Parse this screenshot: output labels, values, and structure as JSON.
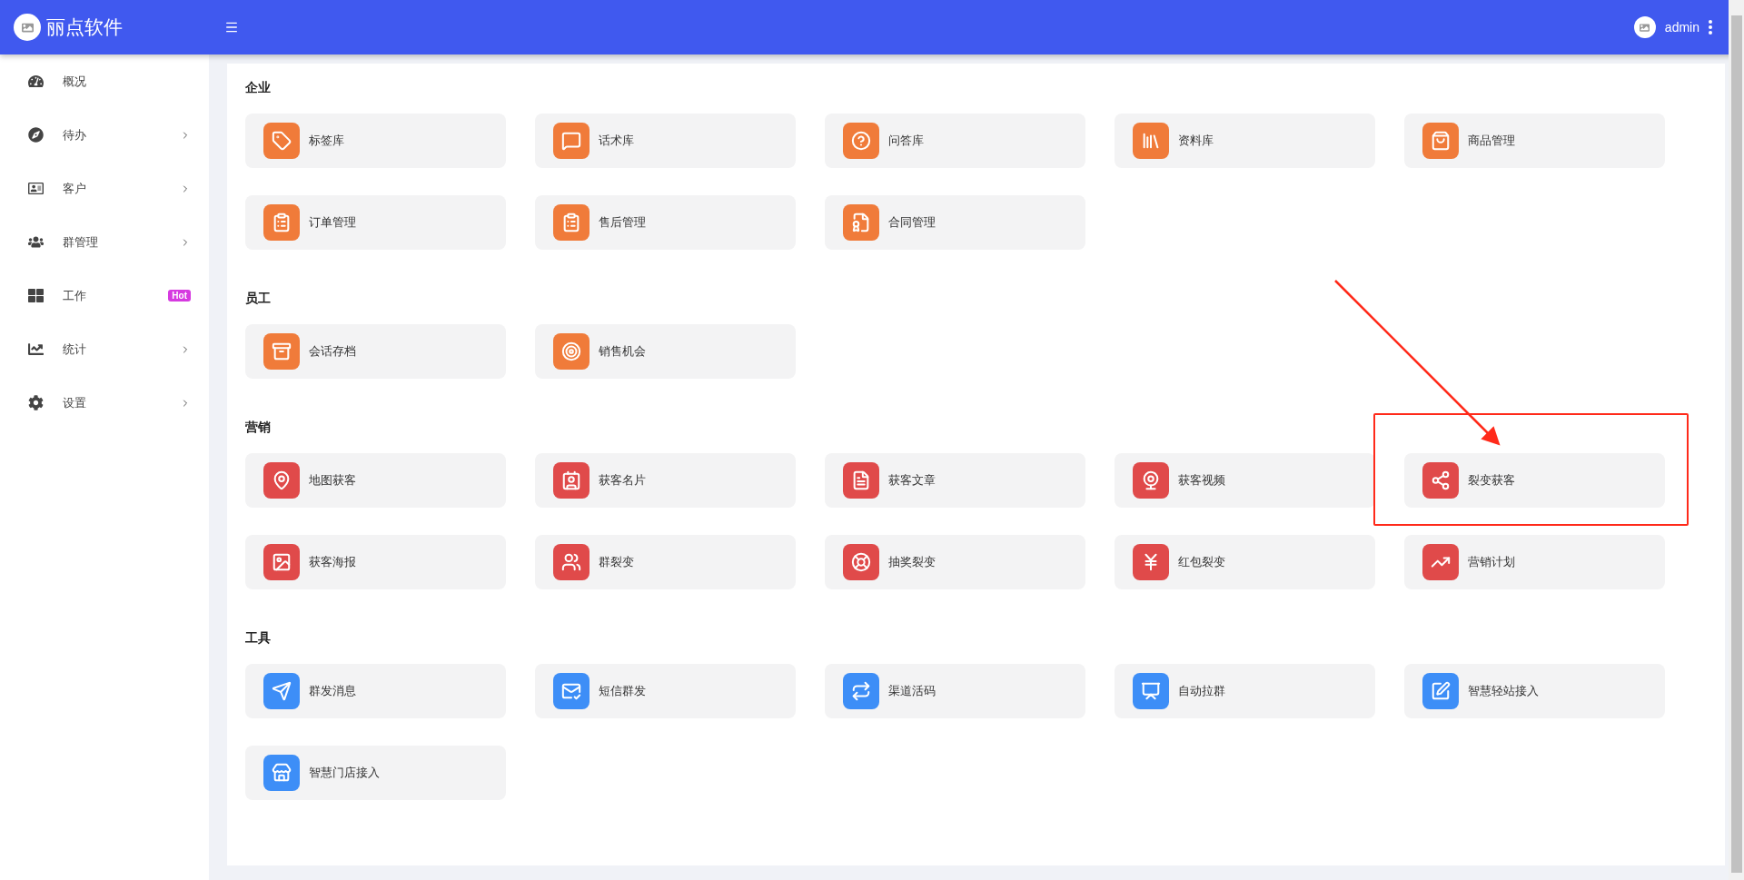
{
  "app": {
    "name": "丽点软件"
  },
  "header": {
    "user": "admin"
  },
  "sidebar": {
    "items": [
      {
        "label": "概况",
        "has_submenu": false
      },
      {
        "label": "待办",
        "has_submenu": true
      },
      {
        "label": "客户",
        "has_submenu": true
      },
      {
        "label": "群管理",
        "has_submenu": true
      },
      {
        "label": "工作",
        "has_submenu": false,
        "badge": "Hot"
      },
      {
        "label": "统计",
        "has_submenu": true
      },
      {
        "label": "设置",
        "has_submenu": true
      }
    ]
  },
  "sections": [
    {
      "title": "企业",
      "color": "#f07b3a",
      "tiles": [
        {
          "label": "标签库"
        },
        {
          "label": "话术库"
        },
        {
          "label": "问答库"
        },
        {
          "label": "资料库"
        },
        {
          "label": "商品管理"
        },
        {
          "label": "订单管理"
        },
        {
          "label": "售后管理"
        },
        {
          "label": "合同管理"
        }
      ]
    },
    {
      "title": "员工",
      "color": "#f07b3a",
      "tiles": [
        {
          "label": "会话存档"
        },
        {
          "label": "销售机会"
        }
      ]
    },
    {
      "title": "营销",
      "color": "#e04a4a",
      "tiles": [
        {
          "label": "地图获客"
        },
        {
          "label": "获客名片"
        },
        {
          "label": "获客文章"
        },
        {
          "label": "获客视频"
        },
        {
          "label": "裂变获客",
          "highlighted": true
        },
        {
          "label": "获客海报"
        },
        {
          "label": "群裂变"
        },
        {
          "label": "抽奖裂变"
        },
        {
          "label": "红包裂变"
        },
        {
          "label": "营销计划"
        }
      ]
    },
    {
      "title": "工具",
      "color": "#3d8ef7",
      "tiles": [
        {
          "label": "群发消息"
        },
        {
          "label": "短信群发"
        },
        {
          "label": "渠道活码"
        },
        {
          "label": "自动拉群"
        },
        {
          "label": "智慧轻站接入"
        },
        {
          "label": "智慧门店接入"
        }
      ]
    }
  ]
}
